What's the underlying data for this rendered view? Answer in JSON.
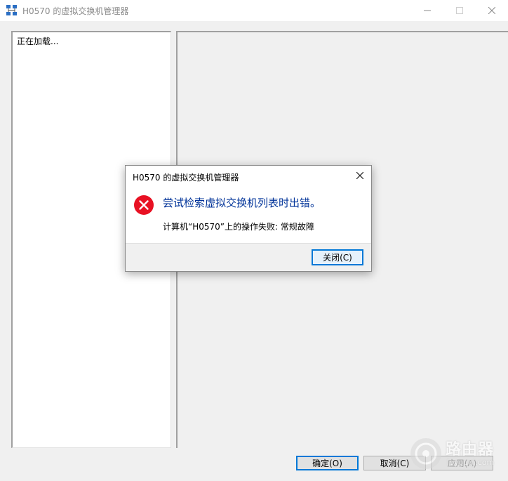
{
  "window": {
    "title": "H0570 的虚拟交换机管理器",
    "app_icon": "network-switch-icon",
    "controls": {
      "minimize": "minimize-icon",
      "maximize": "maximize-icon",
      "close": "close-icon"
    }
  },
  "left_pane": {
    "loading_text": "正在加载..."
  },
  "footer": {
    "ok_label": "确定(O)",
    "cancel_label": "取消(C)",
    "apply_label": "应用(A)"
  },
  "watermark": {
    "title": "路由器",
    "subtitle": "luyouqi.com"
  },
  "dialog": {
    "title": "H0570 的虚拟交换机管理器",
    "icon": "error-icon",
    "main_message": "尝试检索虚拟交换机列表时出错。",
    "detail_message": "计算机“H0570”上的操作失败: 常规故障",
    "close_label": "关闭(C)"
  },
  "colors": {
    "accent": "#0078d7",
    "error": "#e81123",
    "main_message": "#003399"
  }
}
